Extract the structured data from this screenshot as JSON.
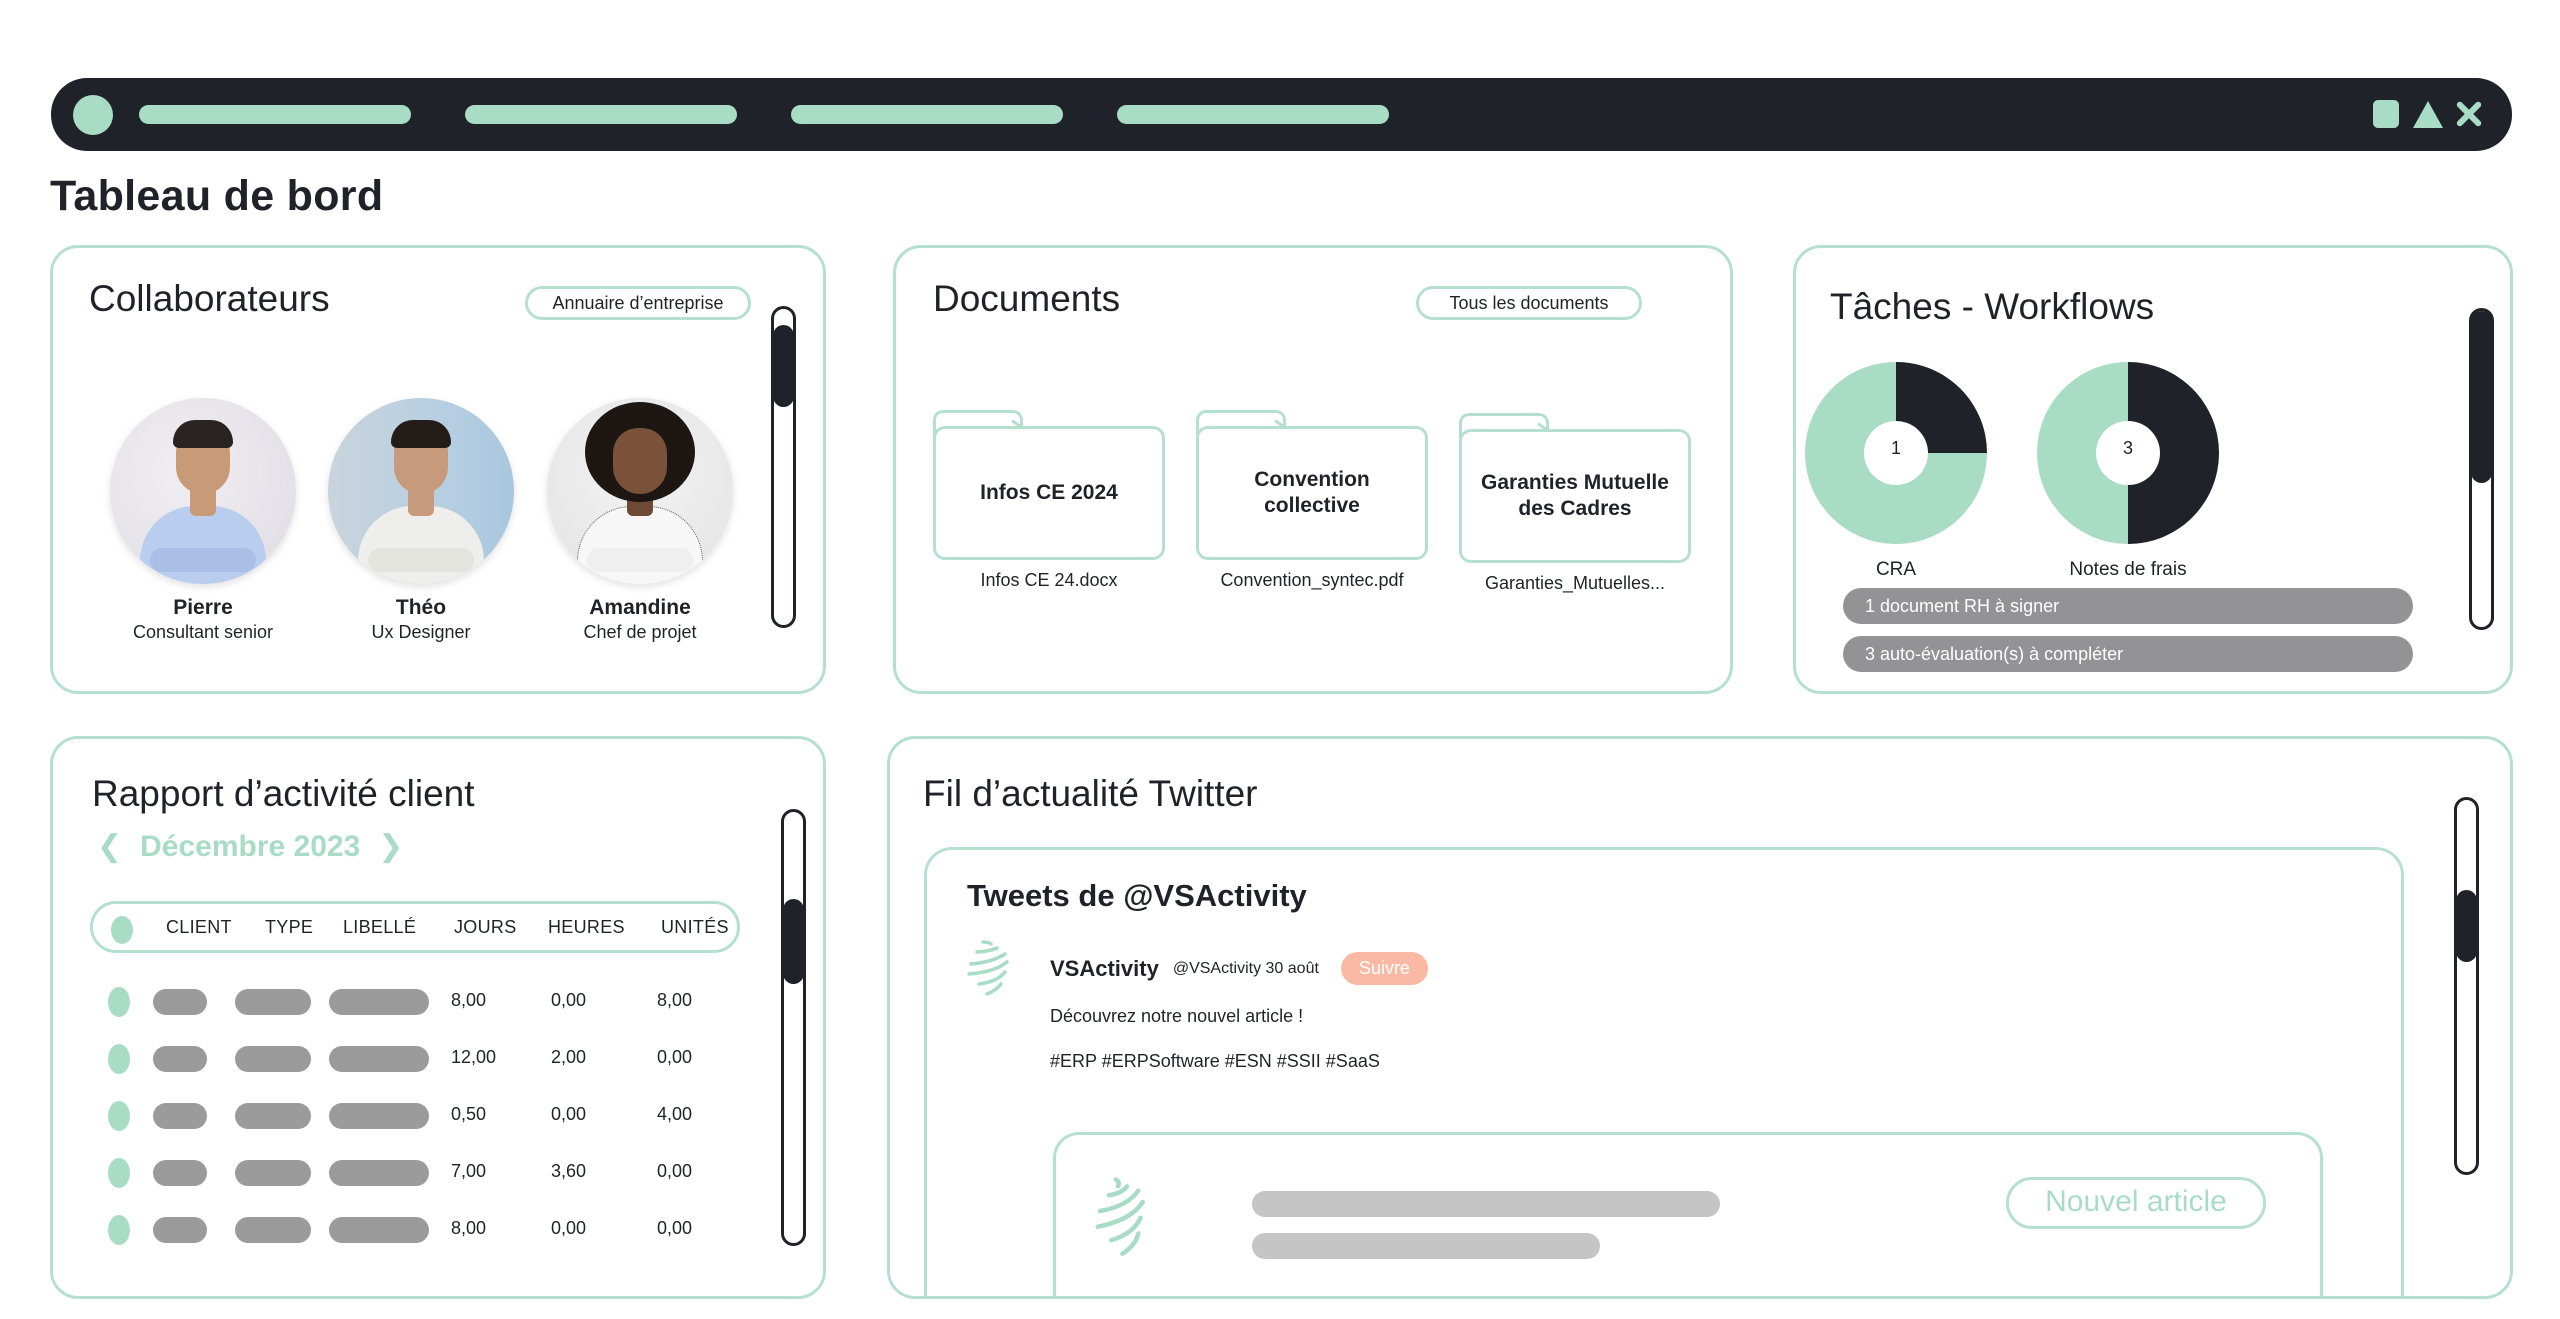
{
  "window": {
    "tabs": [
      "tab-1",
      "tab-2",
      "tab-3",
      "tab-4"
    ],
    "controls": [
      "square-icon",
      "triangle-icon",
      "close-icon"
    ]
  },
  "page_title": "Tableau de bord",
  "colors": {
    "accent": "#a8dcc5",
    "dark": "#1f2329",
    "border": "#b5e0cf",
    "task_bar": "#939396",
    "follow": "#f9b9a4",
    "skeleton": "#c5c5c5"
  },
  "collaborators": {
    "title": "Collaborateurs",
    "directory_button": "Annuaire d’entreprise",
    "scroll_position": 0.07,
    "people": [
      {
        "name": "Pierre",
        "role": "Consultant senior"
      },
      {
        "name": "Théo",
        "role": "Ux Designer"
      },
      {
        "name": "Amandine",
        "role": "Chef de projet"
      }
    ]
  },
  "documents": {
    "title": "Documents",
    "all_button": "Tous les documents",
    "items": [
      {
        "label": "Infos CE 2024",
        "file": "Infos CE 24.docx"
      },
      {
        "label": "Convention collective",
        "file": "Convention_syntec.pdf"
      },
      {
        "label": "Garanties Mutuelle des Cadres",
        "file": "Garanties_Mutuelles..."
      }
    ]
  },
  "tasks": {
    "title": "Tâches - Workflows",
    "scroll_position": 0.0,
    "donuts": [
      {
        "label": "CRA",
        "count": "1",
        "fraction_done": 0.25
      },
      {
        "label": "Notes de frais",
        "count": "3",
        "fraction_done": 0.5
      }
    ],
    "alerts": [
      "1 document RH à signer",
      "3 auto-évaluation(s) à compléter"
    ]
  },
  "report": {
    "title": "Rapport d’activité client",
    "month": "Décembre 2023",
    "prev_icon": "chevron-left-icon",
    "next_icon": "chevron-right-icon",
    "scroll_position": 0.25,
    "columns": [
      "CLIENT",
      "TYPE",
      "LIBELLÉ",
      "JOURS",
      "HEURES",
      "UNITÉS"
    ],
    "rows": [
      {
        "jours": "8,00",
        "heures": "0,00",
        "unites": "8,00"
      },
      {
        "jours": "12,00",
        "heures": "2,00",
        "unites": "0,00"
      },
      {
        "jours": "0,50",
        "heures": "0,00",
        "unites": "4,00"
      },
      {
        "jours": "7,00",
        "heures": "3,60",
        "unites": "0,00"
      },
      {
        "jours": "8,00",
        "heures": "0,00",
        "unites": "0,00"
      }
    ]
  },
  "twitter": {
    "title": "Fil d’actualité Twitter",
    "feed_title": "Tweets de @VSActivity",
    "scroll_position": 0.3,
    "tweet": {
      "name": "VSActivity",
      "handle_date": "@VSActivity 30 août",
      "follow": "Suivre",
      "text": "Découvrez notre nouvel article !",
      "hashtags": "#ERP #ERPSoftware #ESN #SSII #SaaS",
      "card_button": "Nouvel article"
    }
  }
}
